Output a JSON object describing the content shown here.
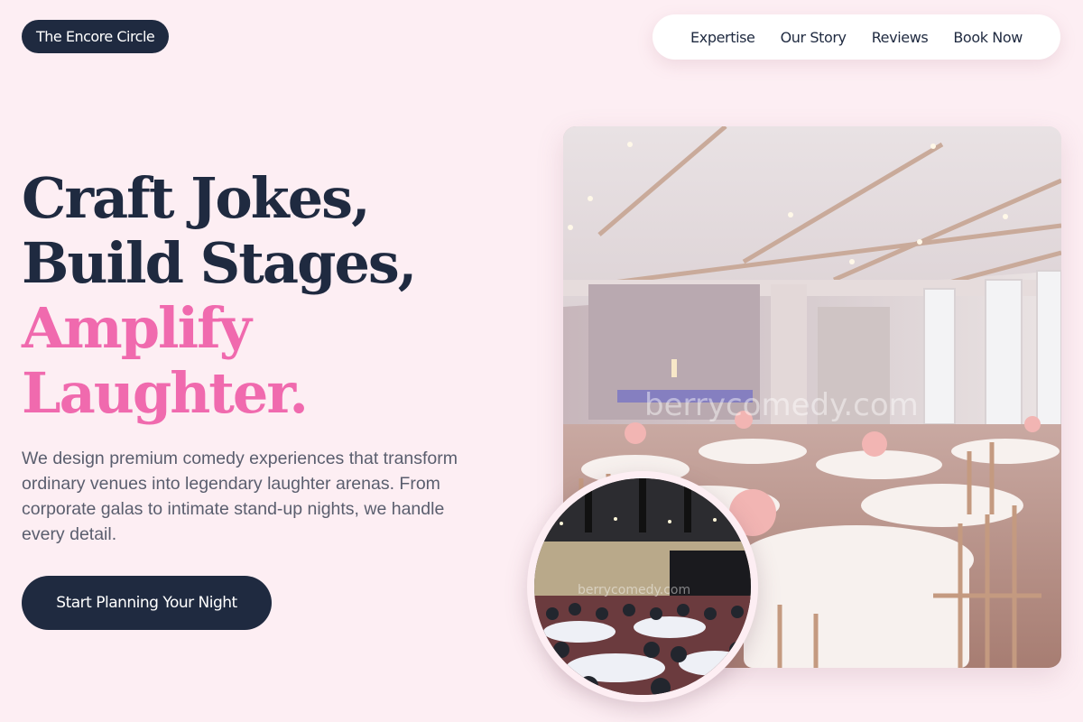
{
  "brand": {
    "name": "The Encore Circle"
  },
  "nav": {
    "items": [
      {
        "label": "Expertise"
      },
      {
        "label": "Our Story"
      },
      {
        "label": "Reviews"
      },
      {
        "label": "Book Now"
      }
    ]
  },
  "hero": {
    "headline_lines": [
      "Craft Jokes,",
      "Build Stages,",
      "Amplify",
      "Laughter."
    ],
    "intro": "We design premium comedy experiences that transform ordinary venues into legendary laughter arenas. From corporate galas to intimate stand-up nights, we handle every detail.",
    "cta_label": "Start Planning Your Night"
  },
  "images": {
    "main_watermark": "berrycomedy.com",
    "inset_watermark": "berrycomedy.com"
  },
  "colors": {
    "background": "#fdeef3",
    "navy": "#1f2a40",
    "accent_pink": "#f06aae",
    "body_text": "#5a5e6e"
  }
}
